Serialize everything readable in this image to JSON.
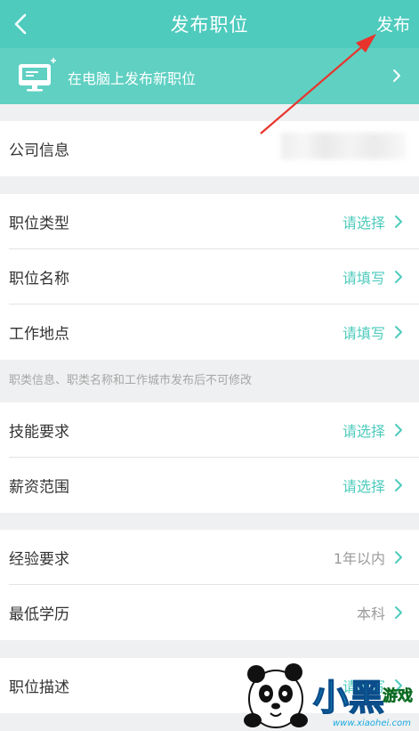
{
  "header": {
    "title": "发布职位",
    "publish_label": "发布"
  },
  "banner": {
    "text": "在电脑上发布新职位"
  },
  "company": {
    "label": "公司信息"
  },
  "fields": {
    "job_type": {
      "label": "职位类型",
      "value": "请选择"
    },
    "job_name": {
      "label": "职位名称",
      "value": "请填写"
    },
    "work_location": {
      "label": "工作地点",
      "value": "请填写"
    },
    "skills": {
      "label": "技能要求",
      "value": "请选择"
    },
    "salary": {
      "label": "薪资范围",
      "value": "请选择"
    },
    "experience": {
      "label": "经验要求",
      "value": "1年以内"
    },
    "education": {
      "label": "最低学历",
      "value": "本科"
    },
    "description": {
      "label": "职位描述",
      "value": "请填写"
    }
  },
  "note": "职类信息、职类名称和工作城市发布后不可修改",
  "watermark": {
    "brand": "小黑",
    "suffix": "游戏",
    "url": "www.xiaohei.com"
  },
  "colors": {
    "accent": "#4ecbbd",
    "banner": "#5fd0c2",
    "annotation_arrow": "#e8342c"
  }
}
